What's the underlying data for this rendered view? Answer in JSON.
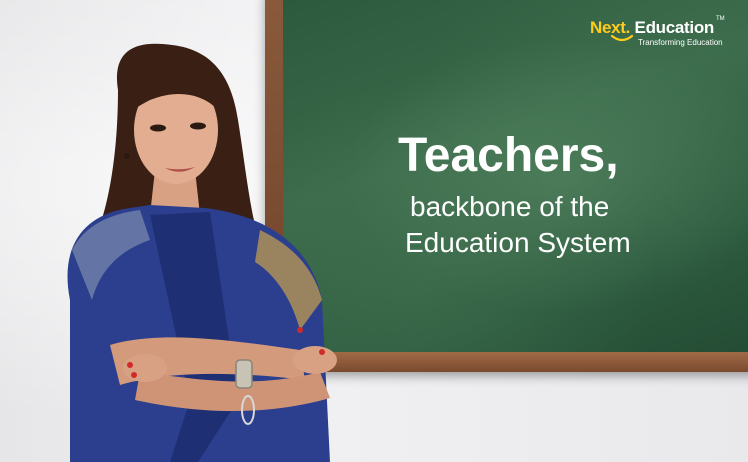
{
  "logo": {
    "brand_next": "Next",
    "brand_rest": "Education",
    "trademark": "TM",
    "tagline": "Transforming Education"
  },
  "board": {
    "headline": "Teachers,",
    "line2": "backbone of the",
    "line3": "Education System"
  },
  "colors": {
    "chalkboard": "#2f5e41",
    "frame": "#7a4a2e",
    "logo_accent": "#ffcc1a",
    "saree": "#2c3f8f",
    "saree_border": "#c9a24a"
  },
  "image_subject": "teacher-with-crossed-arms-portrait"
}
